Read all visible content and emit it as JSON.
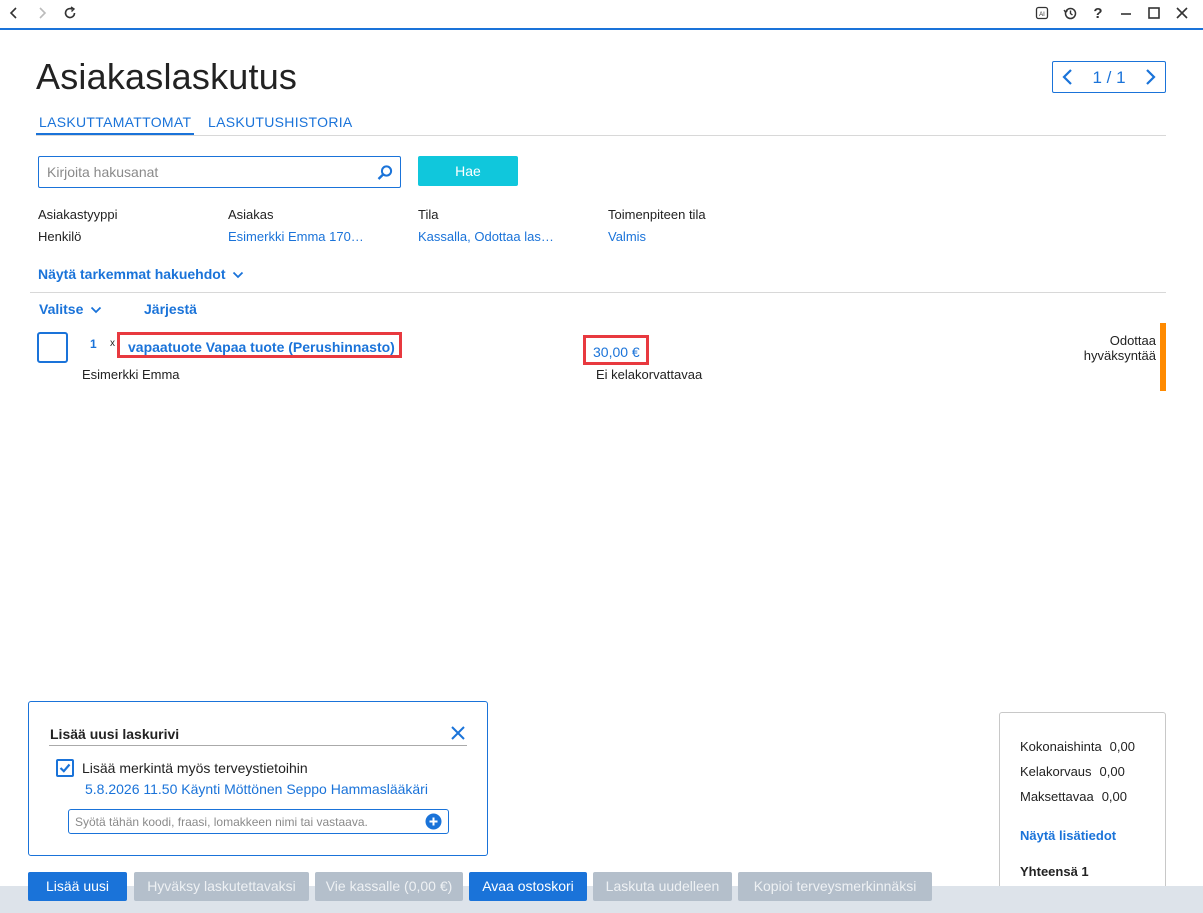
{
  "window": {
    "back_icon": "chevron-left-icon",
    "forward_icon": "chevron-right-icon",
    "refresh_icon": "refresh-icon",
    "ai_icon": "ai-icon",
    "history_icon": "history-icon",
    "help_label": "?",
    "minimize_icon": "minimize-icon",
    "maximize_icon": "maximize-icon",
    "close_icon": "close-icon"
  },
  "page": {
    "title": "Asiakaslaskutus",
    "pager": "1 / 1"
  },
  "tabs": [
    {
      "label": "LASKUTTAMATTOMAT",
      "active": true
    },
    {
      "label": "LASKUTUSHISTORIA",
      "active": false
    }
  ],
  "search": {
    "placeholder": "Kirjoita hakusanat",
    "value": "",
    "button_label": "Hae"
  },
  "filters": [
    {
      "label": "Asiakastyyppi",
      "value": "Henkilö"
    },
    {
      "label": "Asiakas",
      "value": "Esimerkki Emma 170…"
    },
    {
      "label": "Tila",
      "value": "Kassalla, Odottaa las…"
    },
    {
      "label": "Toimenpiteen tila",
      "value": "Valmis"
    }
  ],
  "more_filters_label": "Näytä tarkemmat hakuehdot",
  "list_actions": {
    "select_label": "Valitse",
    "sort_label": "Järjestä"
  },
  "rows": [
    {
      "quantity": "1",
      "times": "x",
      "product": "vapaatuote Vapaa tuote (Perushinnasto)",
      "customer": "Esimerkki Emma",
      "price": "30,00 €",
      "reimbursement": "Ei kelakorvattavaa",
      "status_line1": "Odottaa",
      "status_line2": "hyväksyntää"
    }
  ],
  "add_panel": {
    "title": "Lisää uusi laskurivi",
    "checkbox_label": "Lisää merkintä myös terveystietoihin",
    "checkbox_checked": true,
    "visit_link": "5.8.2026 11.50 Käynti Möttönen Seppo Hammaslääkäri",
    "input_placeholder": "Syötä tähän koodi, fraasi, lomakkeen nimi tai vastaava."
  },
  "summary": {
    "total_price_label": "Kokonaishinta",
    "total_price_value": "0,00",
    "kela_label": "Kelakorvaus",
    "kela_value": "0,00",
    "payable_label": "Maksettavaa",
    "payable_value": "0,00",
    "details_link": "Näytä lisätiedot",
    "count_label": "Yhteensä 1"
  },
  "toolbar": {
    "add_new": "Lisää uusi",
    "approve": "Hyväksy laskutettavaksi",
    "to_checkout": "Vie kassalle (0,00 €)",
    "open_cart": "Avaa ostoskori",
    "rebill": "Laskuta uudelleen",
    "copy": "Kopioi terveysmerkinnäksi"
  },
  "colors": {
    "accent": "#1a73d9",
    "search_button": "#10c7dc",
    "highlight": "#e8393f",
    "status_pending": "#ff8a00",
    "disabled_button": "#b4bfcb"
  }
}
